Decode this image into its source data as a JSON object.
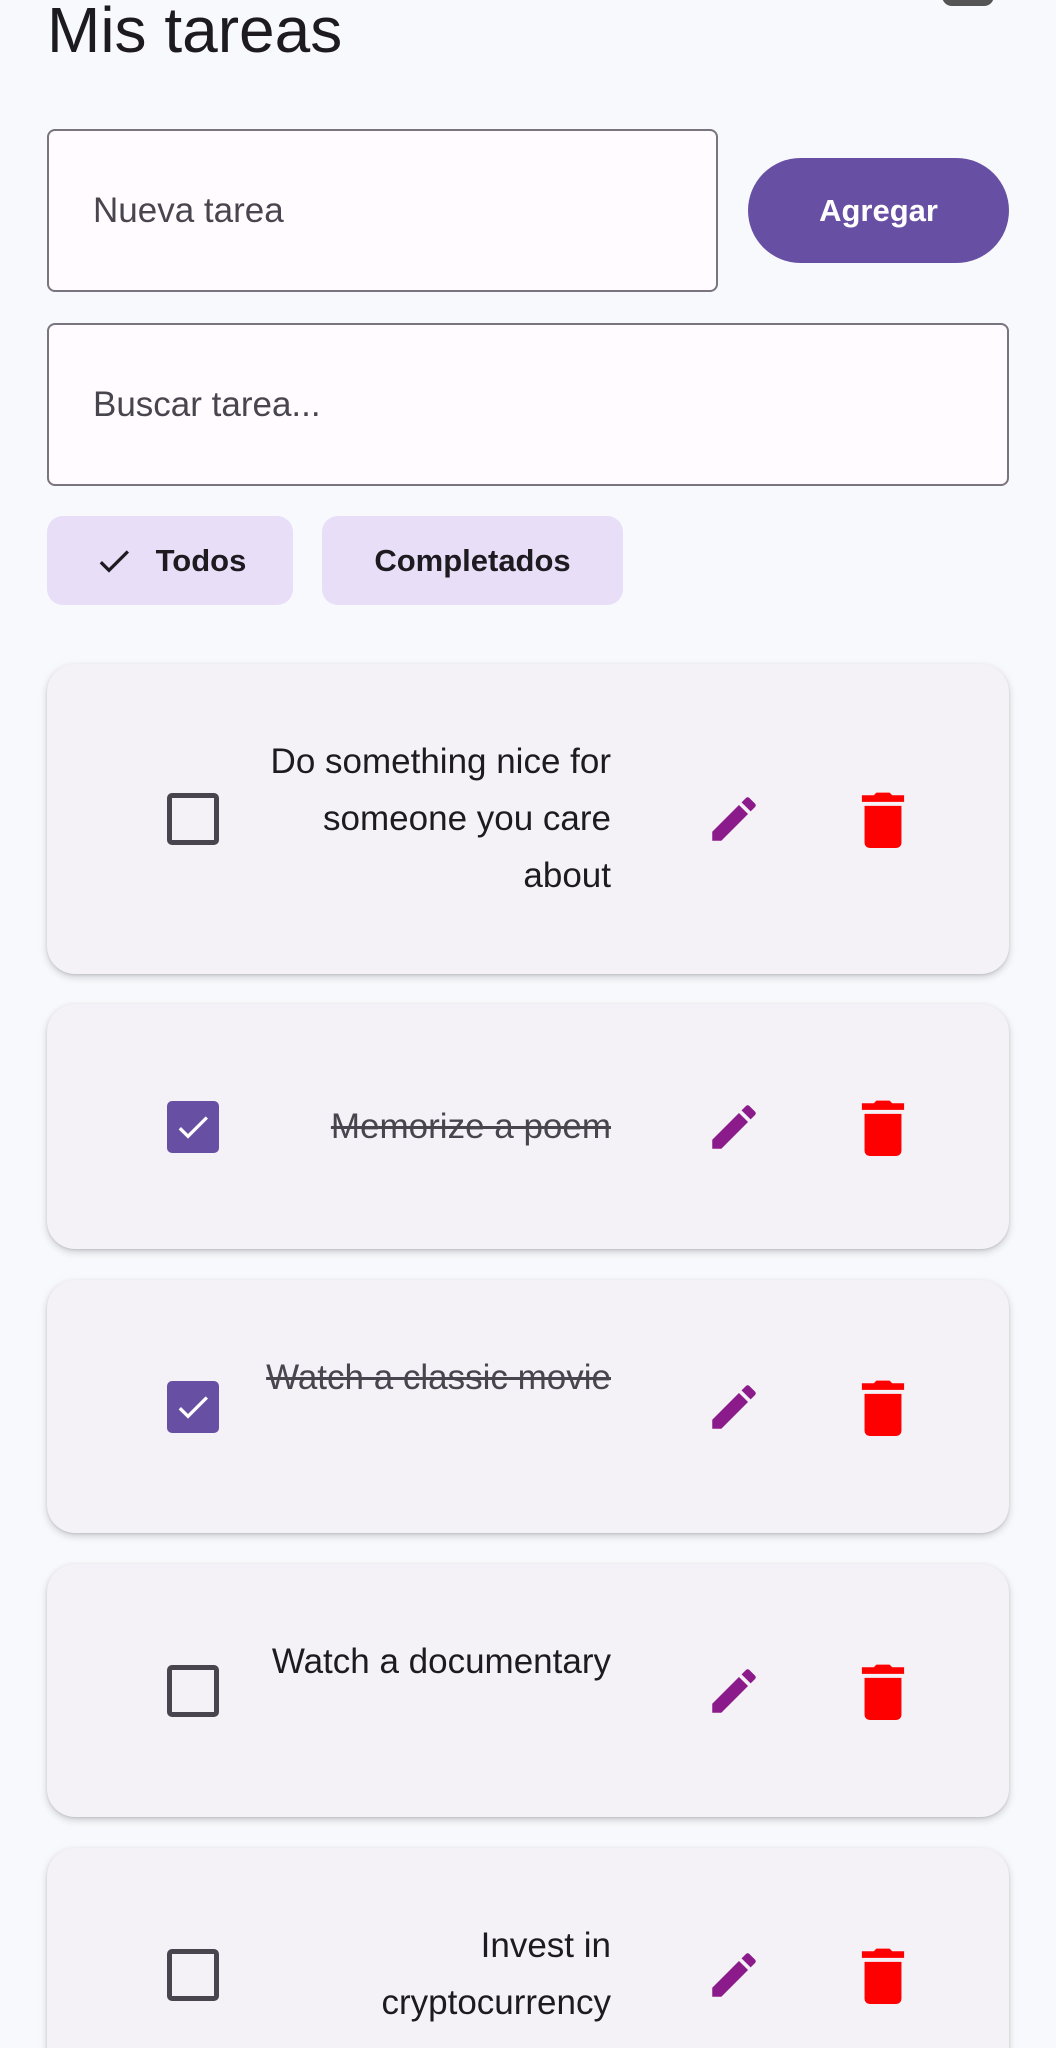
{
  "header": {
    "title": "Mis tareas"
  },
  "new_task": {
    "placeholder": "Nueva tarea"
  },
  "add_button": {
    "label": "Agregar"
  },
  "search": {
    "placeholder": "Buscar tarea..."
  },
  "filters": [
    {
      "label": "Todos",
      "selected": true
    },
    {
      "label": "Completados",
      "selected": false
    }
  ],
  "tasks": [
    {
      "text": "Do something nice for someone you care about",
      "completed": false
    },
    {
      "text": "Memorize a poem",
      "completed": true
    },
    {
      "text": "Watch a classic movie",
      "completed": true
    },
    {
      "text": "Watch a documentary",
      "completed": false
    },
    {
      "text": "Invest in cryptocurrency",
      "completed": false
    }
  ],
  "icons": {
    "edit": "pencil-icon",
    "delete": "trash-icon",
    "chip_selected": "check-icon",
    "checkbox_checked": "check-icon"
  },
  "colors": {
    "primary": "#6750a4",
    "chip_background": "#e8def8",
    "card_background": "#f4f1f7",
    "edit_icon": "#8b1a8b",
    "delete_icon": "#ff0000",
    "page_background": "#f7f9fc"
  }
}
